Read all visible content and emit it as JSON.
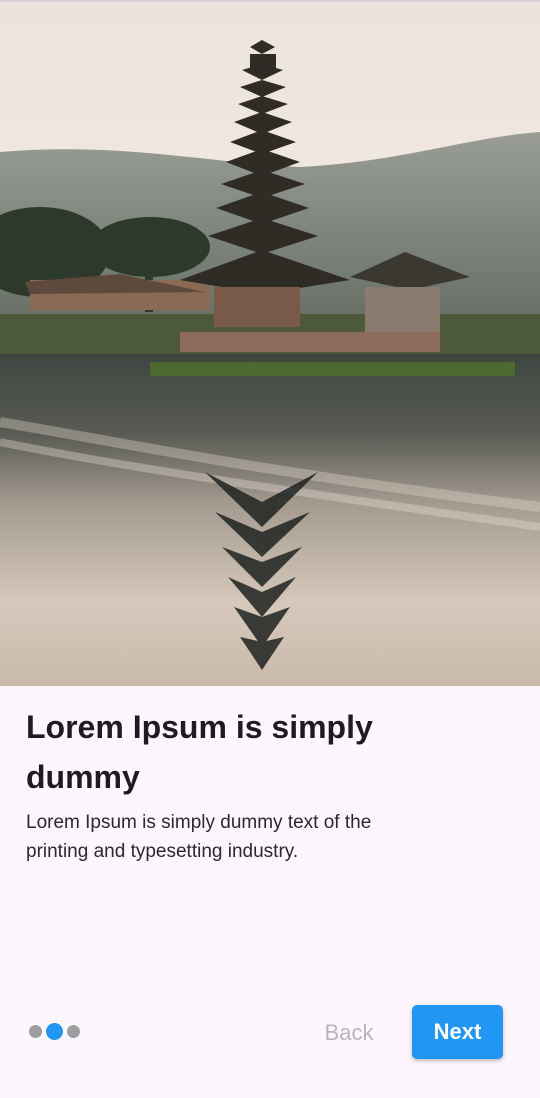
{
  "onboarding": {
    "hero_image_icon": "temple-lake-photo",
    "title": "Lorem Ipsum is simply dummy",
    "description": "Lorem Ipsum is simply dummy text of the printing and typesetting industry.",
    "page_indicator": {
      "total": 3,
      "current": 2
    },
    "back_label": "Back",
    "next_label": "Next"
  },
  "colors": {
    "accent": "#2196f3",
    "background": "#fdf7fd",
    "inactive_dot": "#9e9e9e",
    "disabled_text": "#b8b6b9"
  }
}
